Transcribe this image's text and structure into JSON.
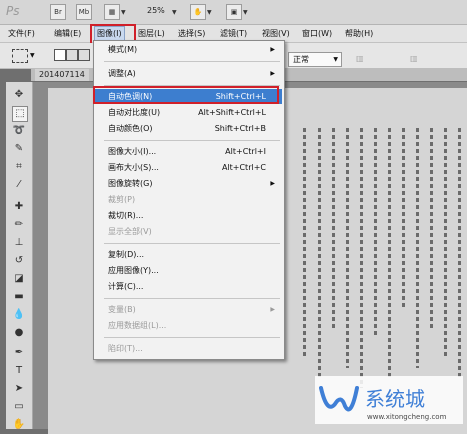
{
  "app": {
    "logo": "Ps",
    "zoom": "25%",
    "br_label": "Br",
    "mb_label": "Mb"
  },
  "menubar": {
    "items": [
      {
        "label": "文件(F)"
      },
      {
        "label": "编辑(E)"
      },
      {
        "label": "图像(I)"
      },
      {
        "label": "图层(L)"
      },
      {
        "label": "选择(S)"
      },
      {
        "label": "滤镜(T)"
      },
      {
        "label": "视图(V)"
      },
      {
        "label": "窗口(W)"
      },
      {
        "label": "帮助(H)"
      }
    ]
  },
  "options": {
    "blend_mode": "正常"
  },
  "document": {
    "tab_label": "201407114"
  },
  "image_menu": {
    "items": [
      {
        "label": "模式(M)",
        "shortcut": "",
        "submenu": true,
        "disabled": false
      },
      {
        "label": "调整(A)",
        "shortcut": "",
        "submenu": true,
        "disabled": false
      },
      {
        "label": "自动色调(N)",
        "shortcut": "Shift+Ctrl+L",
        "submenu": false,
        "disabled": false,
        "highlighted": true
      },
      {
        "label": "自动对比度(U)",
        "shortcut": "Alt+Shift+Ctrl+L",
        "submenu": false,
        "disabled": false
      },
      {
        "label": "自动颜色(O)",
        "shortcut": "Shift+Ctrl+B",
        "submenu": false,
        "disabled": false
      },
      {
        "label": "图像大小(I)...",
        "shortcut": "Alt+Ctrl+I",
        "submenu": false,
        "disabled": false
      },
      {
        "label": "画布大小(S)...",
        "shortcut": "Alt+Ctrl+C",
        "submenu": false,
        "disabled": false
      },
      {
        "label": "图像旋转(G)",
        "shortcut": "",
        "submenu": true,
        "disabled": false
      },
      {
        "label": "裁剪(P)",
        "shortcut": "",
        "submenu": false,
        "disabled": true
      },
      {
        "label": "裁切(R)...",
        "shortcut": "",
        "submenu": false,
        "disabled": false
      },
      {
        "label": "显示全部(V)",
        "shortcut": "",
        "submenu": false,
        "disabled": true
      },
      {
        "label": "复制(D)...",
        "shortcut": "",
        "submenu": false,
        "disabled": false
      },
      {
        "label": "应用图像(Y)...",
        "shortcut": "",
        "submenu": false,
        "disabled": false
      },
      {
        "label": "计算(C)...",
        "shortcut": "",
        "submenu": false,
        "disabled": false
      },
      {
        "label": "变量(B)",
        "shortcut": "",
        "submenu": true,
        "disabled": true
      },
      {
        "label": "应用数据组(L)...",
        "shortcut": "",
        "submenu": false,
        "disabled": true
      },
      {
        "label": "陷印(T)...",
        "shortcut": "",
        "submenu": false,
        "disabled": true
      }
    ]
  },
  "watermark": {
    "text": "ω 系统城",
    "url": "www.xitongcheng.com"
  },
  "colors": {
    "menu_highlight": "#3d7ecf",
    "red_annotation": "#d0202a"
  }
}
